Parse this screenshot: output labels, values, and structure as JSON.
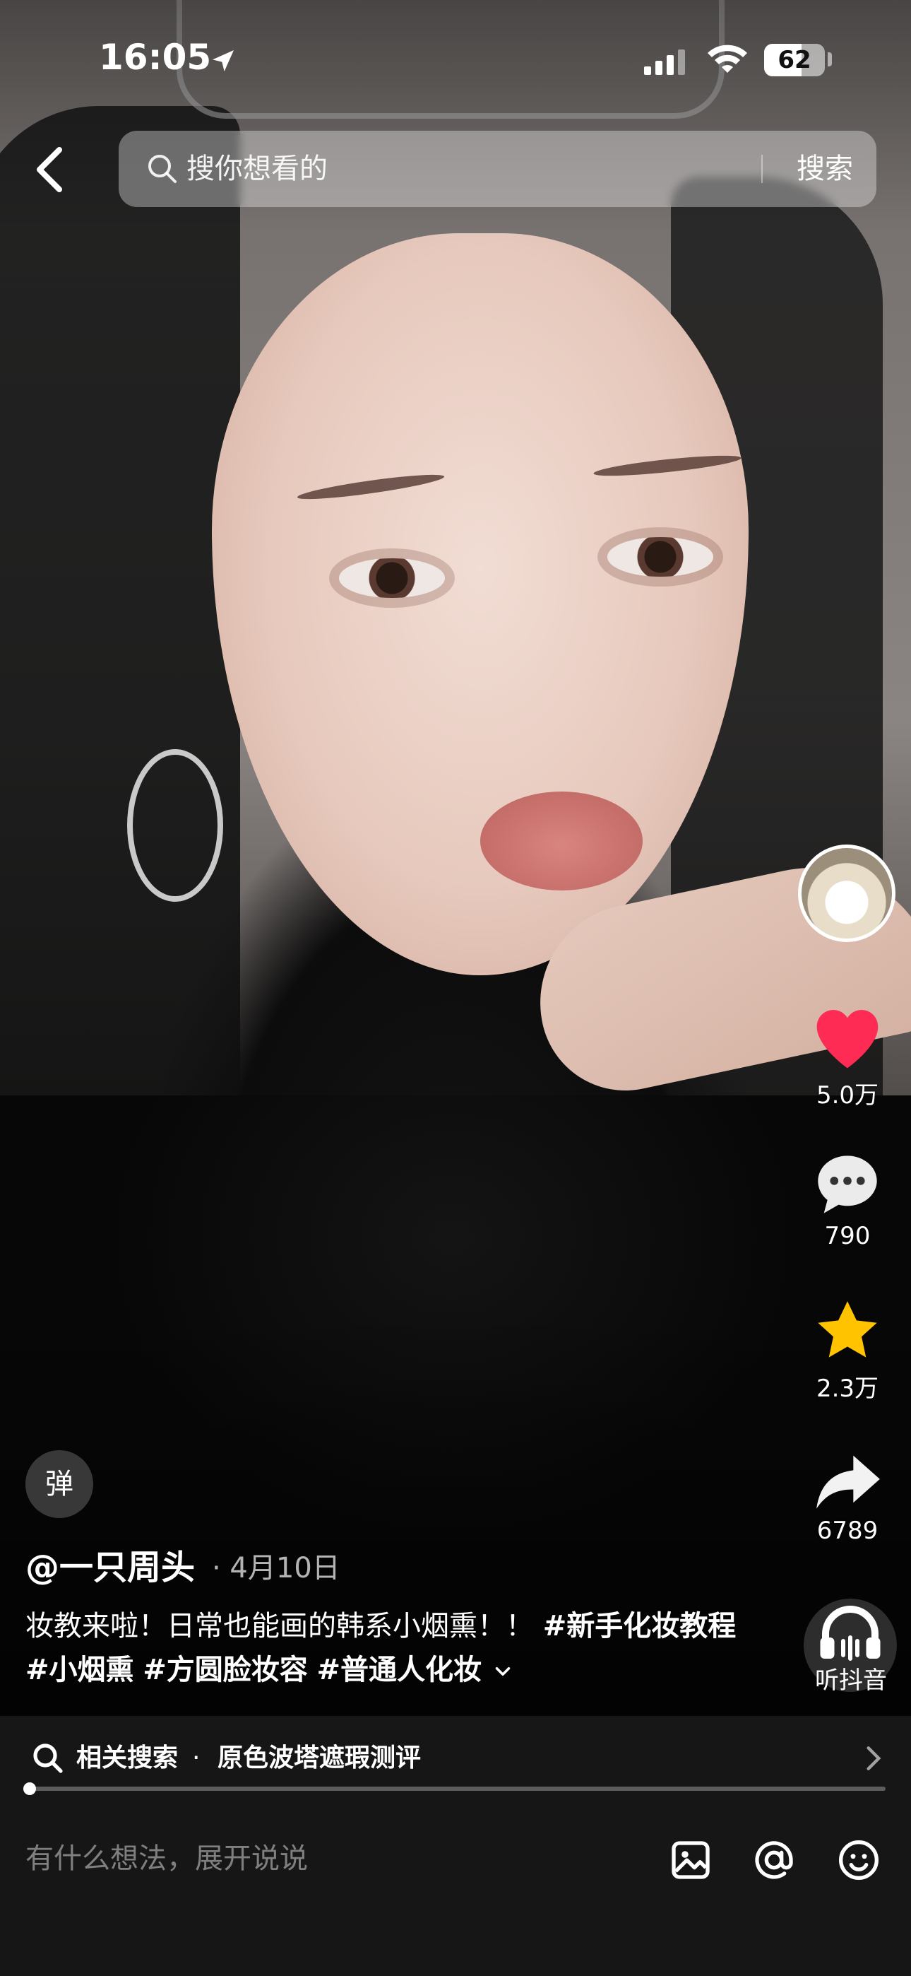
{
  "status_bar": {
    "time": "16:05",
    "battery_percent": "62",
    "battery_level": 0.62
  },
  "search": {
    "placeholder": "搜你想看的",
    "button_label": "搜索"
  },
  "actions": {
    "likes": "5.0万",
    "comments": "790",
    "favorites": "2.3万",
    "shares": "6789",
    "listen_label": "听抖音"
  },
  "post": {
    "danmu_label": "弹",
    "author": "@一只周头",
    "date": "· 4月10日",
    "caption_text": "妆教来啦！日常也能画的韩系小烟熏！！ ",
    "hashtags": [
      "#新手化妆教程",
      "#小烟熏",
      "#方圆脸妆容",
      "#普通人化妆"
    ]
  },
  "related_search": {
    "label": "相关搜索",
    "separator": "·",
    "query": "原色波塔遮瑕测评"
  },
  "playback": {
    "progress": 0.003
  },
  "comment_bar": {
    "placeholder": "有什么想法，展开说说"
  },
  "icons": {
    "like": "heart-icon",
    "comment": "comment-bubble-icon",
    "favorite": "star-icon",
    "share": "share-arrow-icon",
    "listen": "headphones-icon",
    "image": "image-icon",
    "mention": "at-icon",
    "emoji": "emoji-icon"
  },
  "colors": {
    "like": "#fe2c55",
    "favorite": "#ffc300"
  }
}
